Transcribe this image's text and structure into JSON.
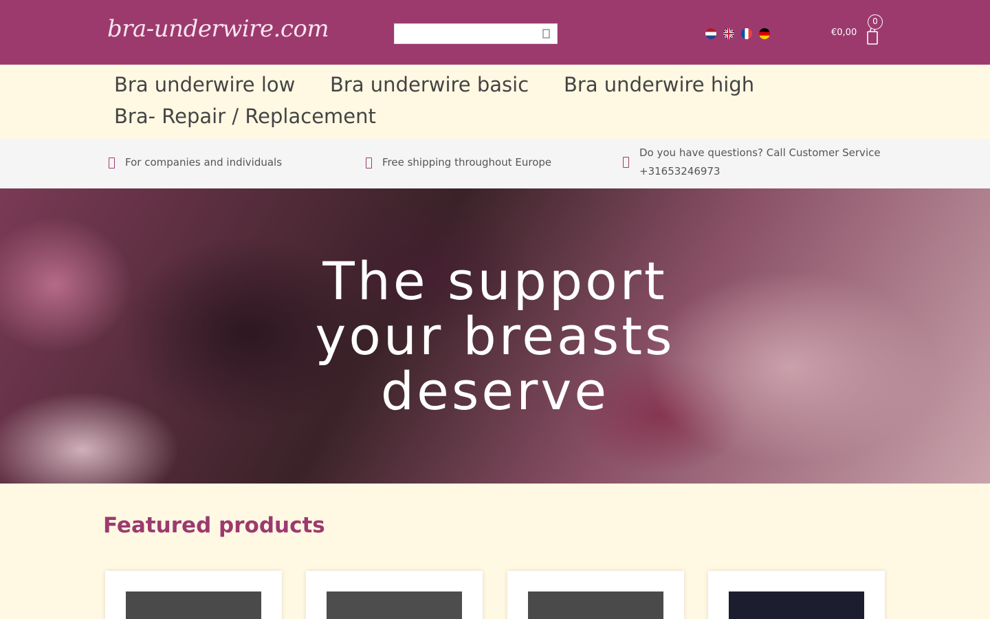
{
  "header": {
    "logo": "bra-underwire.com",
    "search": {
      "placeholder": ""
    },
    "cart": {
      "total": "€0,00",
      "count": "0"
    },
    "languages": [
      "nl",
      "en",
      "fr",
      "de"
    ]
  },
  "nav": {
    "items": [
      {
        "label": "Bra underwire low"
      },
      {
        "label": "Bra underwire basic"
      },
      {
        "label": "Bra underwire high"
      },
      {
        "label": "Bra- Repair / Replacement"
      }
    ]
  },
  "usp": {
    "items": [
      {
        "text": "For companies and individuals"
      },
      {
        "text": "Free shipping throughout Europe"
      },
      {
        "line1": "Do you have questions? Call Customer Service",
        "line2": "+31653246973"
      }
    ]
  },
  "hero": {
    "lines": [
      "The support",
      "your breasts",
      "deserve"
    ]
  },
  "featured": {
    "title": "Featured products",
    "cards": [
      {
        "image_color": "#4a4a4a"
      },
      {
        "image_color": "#4d4d4d"
      },
      {
        "image_color": "#4a4a4a"
      },
      {
        "image_color": "#1c1d2e"
      }
    ]
  },
  "colors": {
    "brand": "#9c3a6e",
    "background": "#fff8e3",
    "usp_bar": "#f5f5f5"
  }
}
